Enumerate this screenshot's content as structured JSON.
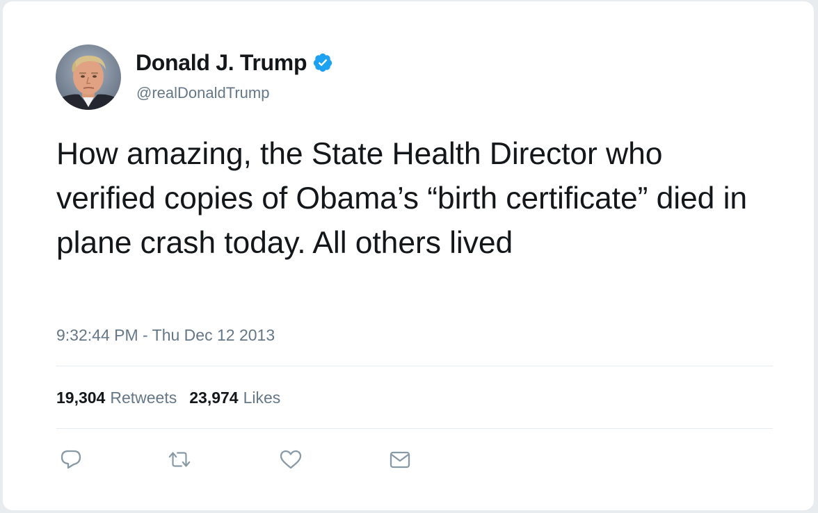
{
  "author": {
    "display_name": "Donald J. Trump",
    "handle": "@realDonaldTrump",
    "verified": true,
    "avatar_icon": "profile-photo"
  },
  "tweet": {
    "text": "How amazing, the State Health Director who verified copies of Obama’s “birth certificate” died in plane crash today. All others lived",
    "timestamp": "9:32:44 PM - Thu Dec 12 2013"
  },
  "stats": {
    "retweets_count": "19,304",
    "retweets_label": "Retweets",
    "likes_count": "23,974",
    "likes_label": "Likes"
  },
  "actions": [
    {
      "name": "reply",
      "icon": "reply-icon"
    },
    {
      "name": "retweet",
      "icon": "retweet-icon"
    },
    {
      "name": "like",
      "icon": "heart-icon"
    },
    {
      "name": "direct-message",
      "icon": "envelope-icon"
    }
  ],
  "colors": {
    "text_primary": "#14171a",
    "text_secondary": "#657786",
    "verified_blue": "#1da1f2",
    "divider": "#e6ecf0"
  }
}
